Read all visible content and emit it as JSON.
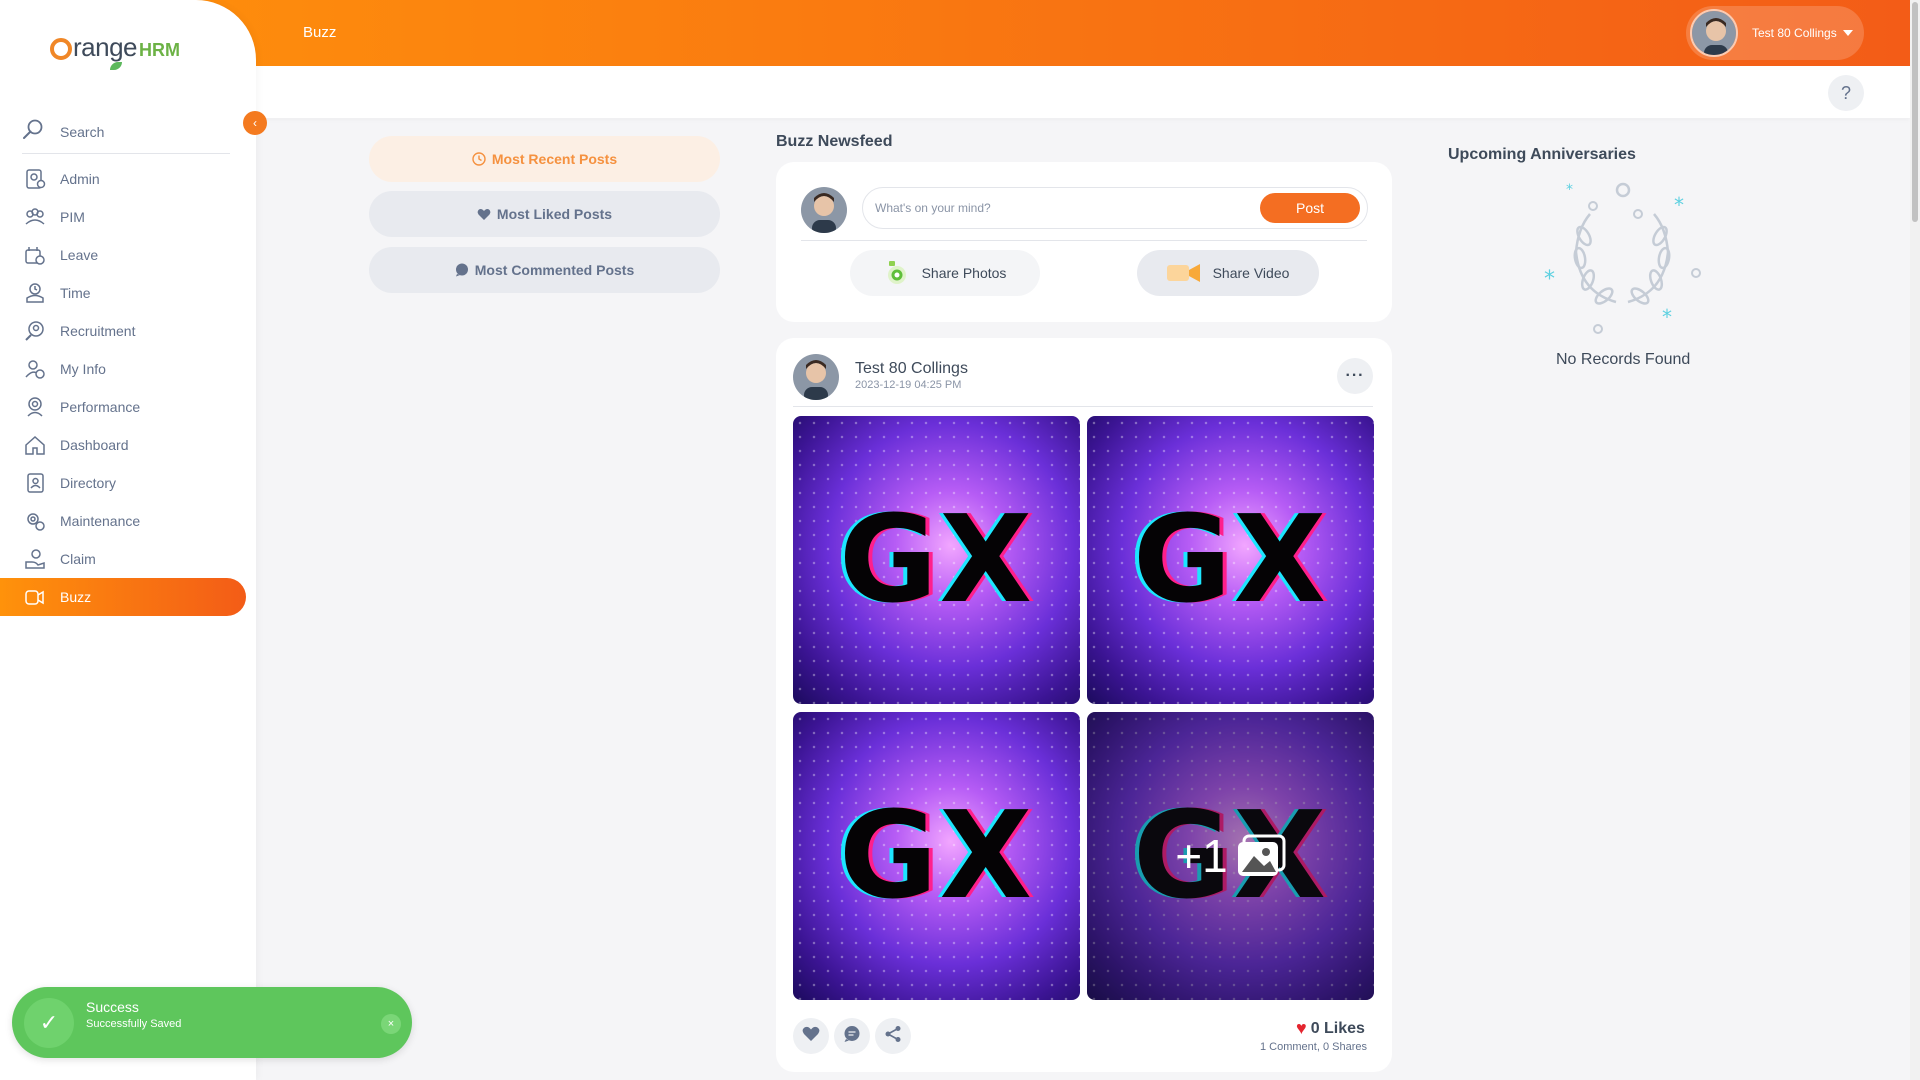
{
  "header": {
    "title": "Buzz",
    "user_name": "Test 80 Collings"
  },
  "help": {
    "label": "?"
  },
  "sidebar": {
    "logo_text": "range",
    "logo_hrm": "HRM",
    "search_label": "Search",
    "collapse_icon": "‹",
    "items": [
      {
        "label": "Admin",
        "icon": "admin-icon"
      },
      {
        "label": "PIM",
        "icon": "pim-icon"
      },
      {
        "label": "Leave",
        "icon": "leave-icon"
      },
      {
        "label": "Time",
        "icon": "time-icon"
      },
      {
        "label": "Recruitment",
        "icon": "recruitment-icon"
      },
      {
        "label": "My Info",
        "icon": "my-info-icon"
      },
      {
        "label": "Performance",
        "icon": "performance-icon"
      },
      {
        "label": "Dashboard",
        "icon": "dashboard-icon"
      },
      {
        "label": "Directory",
        "icon": "directory-icon"
      },
      {
        "label": "Maintenance",
        "icon": "maintenance-icon"
      },
      {
        "label": "Claim",
        "icon": "claim-icon"
      },
      {
        "label": "Buzz",
        "icon": "buzz-icon",
        "active": true
      }
    ]
  },
  "filters": {
    "recent": "Most Recent Posts",
    "liked": "Most Liked Posts",
    "commented": "Most Commented Posts"
  },
  "newsfeed": {
    "title": "Buzz Newsfeed",
    "placeholder": "What's on your mind?",
    "post_label": "Post",
    "share_photos": "Share Photos",
    "share_video": "Share Video"
  },
  "post": {
    "author": "Test 80 Collings",
    "timestamp": "2023-12-19 04:25 PM",
    "menu": "···",
    "photo_text": "GX",
    "more_count": "+1",
    "likes": "0 Likes",
    "comments": "1 Comment",
    "shares": "0 Shares"
  },
  "anniversaries": {
    "title": "Upcoming Anniversaries",
    "empty": "No Records Found"
  },
  "toast": {
    "title": "Success",
    "message": "Successfully Saved",
    "close": "×"
  },
  "colors": {
    "accent": "#f46e22",
    "accent_light": "#ff920b",
    "success": "#5ec65c"
  }
}
